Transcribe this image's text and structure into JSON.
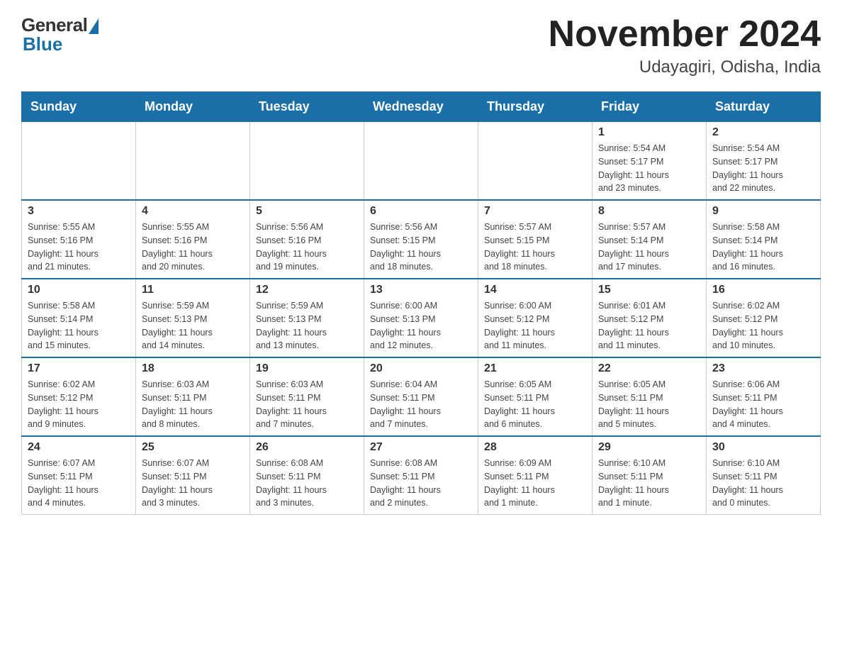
{
  "header": {
    "logo_general": "General",
    "logo_blue": "Blue",
    "month_title": "November 2024",
    "location": "Udayagiri, Odisha, India"
  },
  "weekdays": [
    "Sunday",
    "Monday",
    "Tuesday",
    "Wednesday",
    "Thursday",
    "Friday",
    "Saturday"
  ],
  "weeks": [
    [
      {
        "day": "",
        "info": ""
      },
      {
        "day": "",
        "info": ""
      },
      {
        "day": "",
        "info": ""
      },
      {
        "day": "",
        "info": ""
      },
      {
        "day": "",
        "info": ""
      },
      {
        "day": "1",
        "info": "Sunrise: 5:54 AM\nSunset: 5:17 PM\nDaylight: 11 hours\nand 23 minutes."
      },
      {
        "day": "2",
        "info": "Sunrise: 5:54 AM\nSunset: 5:17 PM\nDaylight: 11 hours\nand 22 minutes."
      }
    ],
    [
      {
        "day": "3",
        "info": "Sunrise: 5:55 AM\nSunset: 5:16 PM\nDaylight: 11 hours\nand 21 minutes."
      },
      {
        "day": "4",
        "info": "Sunrise: 5:55 AM\nSunset: 5:16 PM\nDaylight: 11 hours\nand 20 minutes."
      },
      {
        "day": "5",
        "info": "Sunrise: 5:56 AM\nSunset: 5:16 PM\nDaylight: 11 hours\nand 19 minutes."
      },
      {
        "day": "6",
        "info": "Sunrise: 5:56 AM\nSunset: 5:15 PM\nDaylight: 11 hours\nand 18 minutes."
      },
      {
        "day": "7",
        "info": "Sunrise: 5:57 AM\nSunset: 5:15 PM\nDaylight: 11 hours\nand 18 minutes."
      },
      {
        "day": "8",
        "info": "Sunrise: 5:57 AM\nSunset: 5:14 PM\nDaylight: 11 hours\nand 17 minutes."
      },
      {
        "day": "9",
        "info": "Sunrise: 5:58 AM\nSunset: 5:14 PM\nDaylight: 11 hours\nand 16 minutes."
      }
    ],
    [
      {
        "day": "10",
        "info": "Sunrise: 5:58 AM\nSunset: 5:14 PM\nDaylight: 11 hours\nand 15 minutes."
      },
      {
        "day": "11",
        "info": "Sunrise: 5:59 AM\nSunset: 5:13 PM\nDaylight: 11 hours\nand 14 minutes."
      },
      {
        "day": "12",
        "info": "Sunrise: 5:59 AM\nSunset: 5:13 PM\nDaylight: 11 hours\nand 13 minutes."
      },
      {
        "day": "13",
        "info": "Sunrise: 6:00 AM\nSunset: 5:13 PM\nDaylight: 11 hours\nand 12 minutes."
      },
      {
        "day": "14",
        "info": "Sunrise: 6:00 AM\nSunset: 5:12 PM\nDaylight: 11 hours\nand 11 minutes."
      },
      {
        "day": "15",
        "info": "Sunrise: 6:01 AM\nSunset: 5:12 PM\nDaylight: 11 hours\nand 11 minutes."
      },
      {
        "day": "16",
        "info": "Sunrise: 6:02 AM\nSunset: 5:12 PM\nDaylight: 11 hours\nand 10 minutes."
      }
    ],
    [
      {
        "day": "17",
        "info": "Sunrise: 6:02 AM\nSunset: 5:12 PM\nDaylight: 11 hours\nand 9 minutes."
      },
      {
        "day": "18",
        "info": "Sunrise: 6:03 AM\nSunset: 5:11 PM\nDaylight: 11 hours\nand 8 minutes."
      },
      {
        "day": "19",
        "info": "Sunrise: 6:03 AM\nSunset: 5:11 PM\nDaylight: 11 hours\nand 7 minutes."
      },
      {
        "day": "20",
        "info": "Sunrise: 6:04 AM\nSunset: 5:11 PM\nDaylight: 11 hours\nand 7 minutes."
      },
      {
        "day": "21",
        "info": "Sunrise: 6:05 AM\nSunset: 5:11 PM\nDaylight: 11 hours\nand 6 minutes."
      },
      {
        "day": "22",
        "info": "Sunrise: 6:05 AM\nSunset: 5:11 PM\nDaylight: 11 hours\nand 5 minutes."
      },
      {
        "day": "23",
        "info": "Sunrise: 6:06 AM\nSunset: 5:11 PM\nDaylight: 11 hours\nand 4 minutes."
      }
    ],
    [
      {
        "day": "24",
        "info": "Sunrise: 6:07 AM\nSunset: 5:11 PM\nDaylight: 11 hours\nand 4 minutes."
      },
      {
        "day": "25",
        "info": "Sunrise: 6:07 AM\nSunset: 5:11 PM\nDaylight: 11 hours\nand 3 minutes."
      },
      {
        "day": "26",
        "info": "Sunrise: 6:08 AM\nSunset: 5:11 PM\nDaylight: 11 hours\nand 3 minutes."
      },
      {
        "day": "27",
        "info": "Sunrise: 6:08 AM\nSunset: 5:11 PM\nDaylight: 11 hours\nand 2 minutes."
      },
      {
        "day": "28",
        "info": "Sunrise: 6:09 AM\nSunset: 5:11 PM\nDaylight: 11 hours\nand 1 minute."
      },
      {
        "day": "29",
        "info": "Sunrise: 6:10 AM\nSunset: 5:11 PM\nDaylight: 11 hours\nand 1 minute."
      },
      {
        "day": "30",
        "info": "Sunrise: 6:10 AM\nSunset: 5:11 PM\nDaylight: 11 hours\nand 0 minutes."
      }
    ]
  ]
}
